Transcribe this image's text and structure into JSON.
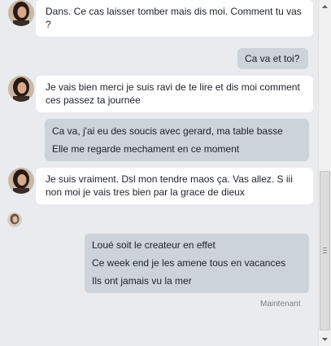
{
  "conversation": {
    "messages": [
      {
        "direction": "in",
        "lines": [
          "Dans. Ce cas laisser tomber mais dis moi. Comment tu vas ?"
        ]
      },
      {
        "direction": "out",
        "lines": [
          "Ca va et toi?"
        ]
      },
      {
        "direction": "in",
        "lines": [
          "Je vais bien merci je suis ravi de te lire et dis moi comment ces passez ta journée"
        ]
      },
      {
        "direction": "out",
        "lines": [
          "Ca va, j'ai eu des soucis avec gerard, ma table basse",
          "Elle me regarde mechament en ce moment"
        ]
      },
      {
        "direction": "in",
        "lines": [
          "Je suis vraiment. Dsl mon tendre maos ça. Vas allez. S iii non moi je vais tres bien par la grace de dieux"
        ]
      },
      {
        "direction": "out",
        "lines": [
          "Loué soit le createur en effet",
          "Ce week end je les amene tous en vacances",
          "Ils ont jamais vu la mer"
        ]
      }
    ],
    "status": "Maintenant"
  },
  "colors": {
    "background": "#e9ebee",
    "incoming_bubble": "#ffffff",
    "outgoing_bubble": "#ccd3da",
    "text": "#1d2129",
    "status_text": "#7f7f7f"
  },
  "icons": {
    "contact_avatar": "contact-avatar-icon",
    "seen_avatar": "seen-avatar-icon",
    "scroll_up": "scroll-up-arrow-icon",
    "scroll_down": "scroll-down-arrow-icon"
  }
}
